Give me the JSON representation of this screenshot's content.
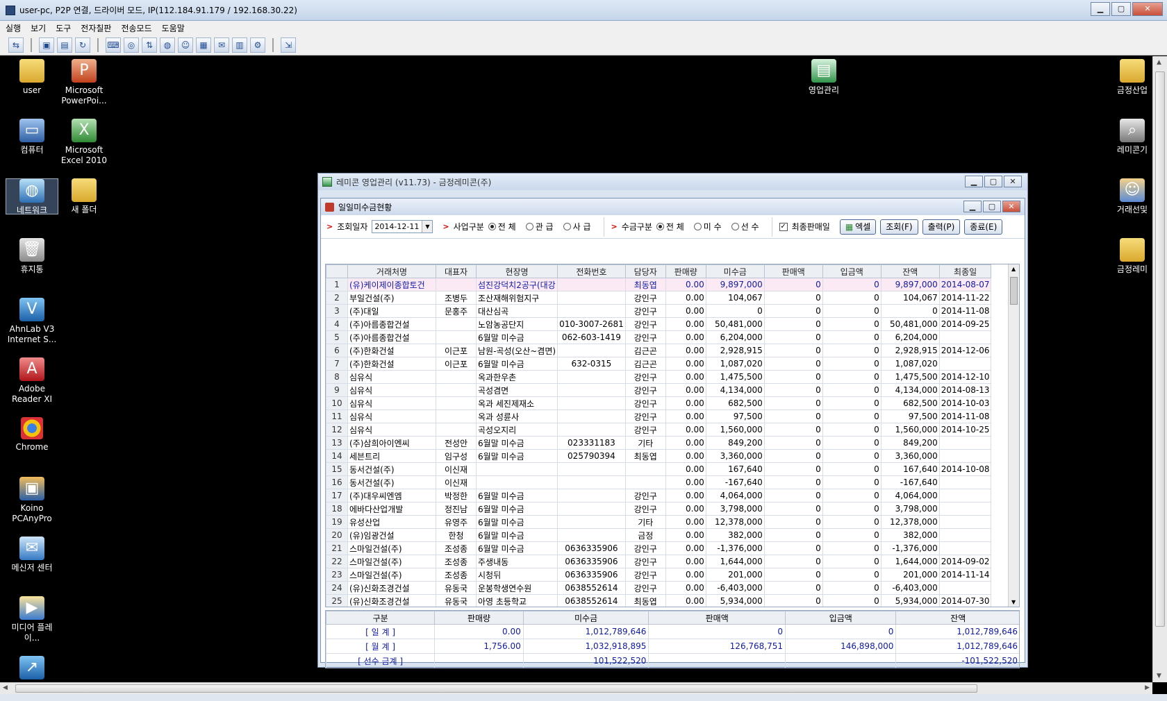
{
  "remote_window": {
    "title": "user-pc, P2P 연결, 드라이버 모드, IP(112.184.91.179 / 192.168.30.22)",
    "menu": [
      "실행",
      "보기",
      "도구",
      "전자칠판",
      "전송모드",
      "도움말"
    ]
  },
  "desktop_icons": {
    "user": "user",
    "powerpoint": "Microsoft PowerPoi...",
    "computer": "컴퓨터",
    "excel": "Microsoft Excel 2010",
    "network": "네트워크",
    "new_folder": "새 폴더",
    "recycle": "휴지통",
    "ahnlab": "AhnLab V3 Internet S...",
    "adobe": "Adobe Reader XI",
    "chrome": "Chrome",
    "koino": "Koino PCAnyPro",
    "messenger": "메신저 센터",
    "media": "미디어 플레이...",
    "sales": "영업관리",
    "right1": "금정산업",
    "right2": "레미콘기",
    "right3": "거래선및",
    "right4": "금정레미"
  },
  "app_window": {
    "title": "레미콘 영업관리 (v11.73) - 금정레미콘(주)"
  },
  "child_window": {
    "title": "일일미수금현황"
  },
  "filters": {
    "date_label": "조회일자",
    "date_value": "2014-12-11",
    "biz_label": "사업구분",
    "biz_options": [
      "전 체",
      "관 급",
      "사 급"
    ],
    "collect_label": "수금구분",
    "collect_options": [
      "전 체",
      "미 수",
      "선 수"
    ],
    "last_sale_label": "최종판매일",
    "excel_btn": "엑셀",
    "query_btn": "조회(F)",
    "print_btn": "출력(P)",
    "close_btn": "종료(E)"
  },
  "grid": {
    "headers": [
      "",
      "거래처명",
      "대표자",
      "현장명",
      "전화번호",
      "담당자",
      "판매량",
      "미수금",
      "판매액",
      "입금액",
      "잔액",
      "최종일"
    ],
    "rows": [
      [
        "1",
        "(유)케이제이종합토건",
        "",
        "섬진강덕치2공구(대강",
        "",
        "최동엽",
        "0.00",
        "9,897,000",
        "0",
        "0",
        "9,897,000",
        "2014-08-07"
      ],
      [
        "2",
        "부일건설(주)",
        "조병두",
        "조산재해위험지구",
        "",
        "강인구",
        "0.00",
        "104,067",
        "0",
        "0",
        "104,067",
        "2014-11-22"
      ],
      [
        "3",
        "(주)대일",
        "문홍주",
        "대산심곡",
        "",
        "강인구",
        "0.00",
        "0",
        "0",
        "0",
        "0",
        "2014-11-08"
      ],
      [
        "4",
        "(주)아름종합건설",
        "",
        "노암농공단지",
        "010-3007-2681",
        "강인구",
        "0.00",
        "50,481,000",
        "0",
        "0",
        "50,481,000",
        "2014-09-25"
      ],
      [
        "5",
        "(주)아름종합건설",
        "",
        "6월말 미수금",
        "062-603-1419",
        "강인구",
        "0.00",
        "6,204,000",
        "0",
        "0",
        "6,204,000",
        ""
      ],
      [
        "6",
        "(주)한화건설",
        "이근포",
        "남원-곡성(오산~겸면)",
        "",
        "김근곤",
        "0.00",
        "2,928,915",
        "0",
        "0",
        "2,928,915",
        "2014-12-06"
      ],
      [
        "7",
        "(주)한화건설",
        "이근포",
        "6월말 미수금",
        "632-0315",
        "김근곤",
        "0.00",
        "1,087,020",
        "0",
        "0",
        "1,087,020",
        ""
      ],
      [
        "8",
        "심유식",
        "",
        "옥과한우촌",
        "",
        "강인구",
        "0.00",
        "1,475,500",
        "0",
        "0",
        "1,475,500",
        "2014-12-10"
      ],
      [
        "9",
        "심유식",
        "",
        "곡성겸면",
        "",
        "강인구",
        "0.00",
        "4,134,000",
        "0",
        "0",
        "4,134,000",
        "2014-08-13"
      ],
      [
        "10",
        "심유식",
        "",
        "옥과 세진제재소",
        "",
        "강인구",
        "0.00",
        "682,500",
        "0",
        "0",
        "682,500",
        "2014-10-03"
      ],
      [
        "11",
        "심유식",
        "",
        "옥과 성륜사",
        "",
        "강인구",
        "0.00",
        "97,500",
        "0",
        "0",
        "97,500",
        "2014-11-08"
      ],
      [
        "12",
        "심유식",
        "",
        "곡성오지리",
        "",
        "강인구",
        "0.00",
        "1,560,000",
        "0",
        "0",
        "1,560,000",
        "2014-10-25"
      ],
      [
        "13",
        "(주)삼희아이엔씨",
        "전성안",
        "6월말 미수금",
        "023331183",
        "기타",
        "0.00",
        "849,200",
        "0",
        "0",
        "849,200",
        ""
      ],
      [
        "14",
        "세븐트리",
        "임구성",
        "6월말 미수금",
        "025790394",
        "최동엽",
        "0.00",
        "3,360,000",
        "0",
        "0",
        "3,360,000",
        ""
      ],
      [
        "15",
        "동서건설(주)",
        "이신재",
        "",
        "",
        "",
        "0.00",
        "167,640",
        "0",
        "0",
        "167,640",
        "2014-10-08"
      ],
      [
        "16",
        "동서건설(주)",
        "이신재",
        "",
        "",
        "",
        "0.00",
        "-167,640",
        "0",
        "0",
        "-167,640",
        ""
      ],
      [
        "17",
        "(주)대우씨엔엠",
        "박정한",
        "6월말 미수금",
        "",
        "강인구",
        "0.00",
        "4,064,000",
        "0",
        "0",
        "4,064,000",
        ""
      ],
      [
        "18",
        "에바다산업개발",
        "정진남",
        "6월말 미수금",
        "",
        "강인구",
        "0.00",
        "3,798,000",
        "0",
        "0",
        "3,798,000",
        ""
      ],
      [
        "19",
        "유성산업",
        "유영주",
        "6월말 미수금",
        "",
        "기타",
        "0.00",
        "12,378,000",
        "0",
        "0",
        "12,378,000",
        ""
      ],
      [
        "20",
        "(유)임광건설",
        "한청",
        "6월말 미수금",
        "",
        "금정",
        "0.00",
        "382,000",
        "0",
        "0",
        "382,000",
        ""
      ],
      [
        "21",
        "스마일건설(주)",
        "조성종",
        "6월말 미수금",
        "0636335906",
        "강인구",
        "0.00",
        "-1,376,000",
        "0",
        "0",
        "-1,376,000",
        ""
      ],
      [
        "22",
        "스마일건설(주)",
        "조성종",
        "주생내동",
        "0636335906",
        "강인구",
        "0.00",
        "1,644,000",
        "0",
        "0",
        "1,644,000",
        "2014-09-02"
      ],
      [
        "23",
        "스마일건설(주)",
        "조성종",
        "시청뒤",
        "0636335906",
        "강인구",
        "0.00",
        "201,000",
        "0",
        "0",
        "201,000",
        "2014-11-14"
      ],
      [
        "24",
        "(유)신화조경건설",
        "유동국",
        "운봉학생연수원",
        "0638552614",
        "강인구",
        "0.00",
        "-6,403,000",
        "0",
        "0",
        "-6,403,000",
        ""
      ],
      [
        "25",
        "(유)신화조경건설",
        "유동국",
        "아영 초등학교",
        "0638552614",
        "최동엽",
        "0.00",
        "5,934,000",
        "0",
        "0",
        "5,934,000",
        "2014-07-30"
      ]
    ]
  },
  "summary": {
    "headers": [
      "구분",
      "판매량",
      "미수금",
      "판매액",
      "입금액",
      "잔액"
    ],
    "rows": [
      [
        "[ 일 계 ]",
        "0.00",
        "1,012,789,646",
        "0",
        "0",
        "1,012,789,646"
      ],
      [
        "[ 월 계 ]",
        "1,756.00",
        "1,032,918,895",
        "126,768,751",
        "146,898,000",
        "1,012,789,646"
      ],
      [
        "[ 선수 금계 ]",
        "",
        "101,522,520",
        "",
        "",
        "-101,522,520"
      ]
    ]
  }
}
